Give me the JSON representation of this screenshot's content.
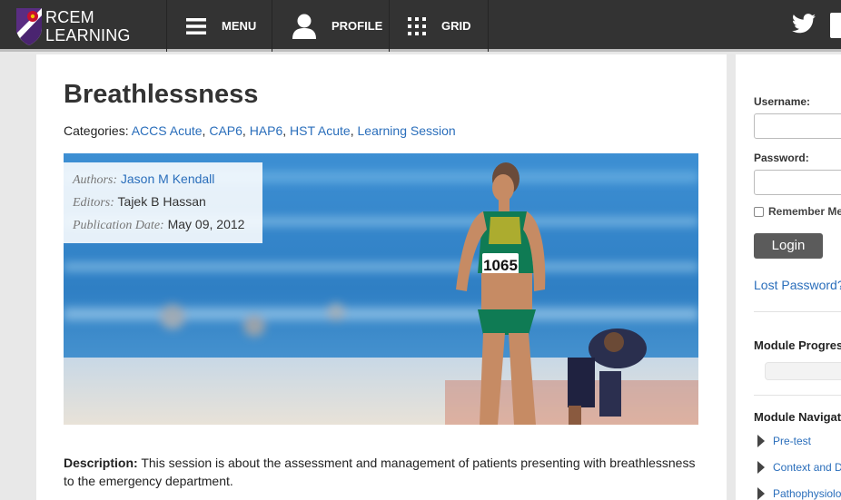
{
  "header": {
    "logo_line1": "RCEM",
    "logo_line2": "LEARNING",
    "nav": [
      {
        "label": "MENU",
        "icon": "hamburger-icon"
      },
      {
        "label": "PROFILE",
        "icon": "user-icon"
      },
      {
        "label": "GRID",
        "icon": "grid-icon"
      }
    ],
    "social_icon": "twitter-icon"
  },
  "article": {
    "title": "Breathlessness",
    "categories_label": "Categories:",
    "categories": [
      "ACCS Acute",
      "CAP6",
      "HAP6",
      "HST Acute",
      "Learning Session"
    ],
    "authors_label": "Authors:",
    "authors": "Jason M Kendall",
    "editors_label": "Editors:",
    "editors": "Tajek B Hassan",
    "pubdate_label": "Publication Date:",
    "pubdate": "May 09, 2012",
    "hero_bib_number": "1065",
    "description_label": "Description:",
    "description": "This session is about the assessment and management of patients presenting with breathlessness to the emergency department."
  },
  "sidebar": {
    "username_label": "Username:",
    "password_label": "Password:",
    "remember_label": "Remember Me",
    "login_label": "Login",
    "lost_password": "Lost Password?",
    "progress_heading": "Module Progress",
    "navigation_heading": "Module Navigation",
    "nav_items": [
      "Pre-test",
      "Context and Definition",
      "Pathophysiology"
    ]
  },
  "colors": {
    "topbar": "#333333",
    "link": "#2a6ebb",
    "button": "#5b5b5b",
    "shield_purple": "#5a2d82",
    "rose_red": "#c8102e"
  }
}
